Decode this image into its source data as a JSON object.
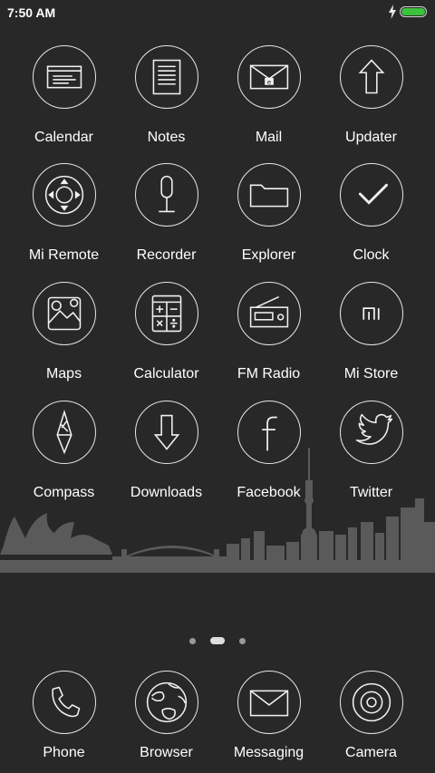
{
  "status_bar": {
    "time": "7:50 AM",
    "battery_level": 1.0,
    "battery_color": "#3cc23c",
    "charging": true
  },
  "apps": [
    {
      "label": "Calendar",
      "icon": "calendar-icon"
    },
    {
      "label": "Notes",
      "icon": "notes-icon"
    },
    {
      "label": "Mail",
      "icon": "mail-icon"
    },
    {
      "label": "Updater",
      "icon": "updater-icon"
    },
    {
      "label": "Mi Remote",
      "icon": "remote-icon"
    },
    {
      "label": "Recorder",
      "icon": "microphone-icon"
    },
    {
      "label": "Explorer",
      "icon": "folder-icon"
    },
    {
      "label": "Clock",
      "icon": "checkmark-icon"
    },
    {
      "label": "Maps",
      "icon": "map-icon"
    },
    {
      "label": "Calculator",
      "icon": "calculator-icon"
    },
    {
      "label": "FM Radio",
      "icon": "radio-icon"
    },
    {
      "label": "Mi Store",
      "icon": "mi-logo-icon"
    },
    {
      "label": "Compass",
      "icon": "compass-icon"
    },
    {
      "label": "Downloads",
      "icon": "download-arrow-icon"
    },
    {
      "label": "Facebook",
      "icon": "facebook-icon"
    },
    {
      "label": "Twitter",
      "icon": "twitter-bird-icon"
    }
  ],
  "page_indicator": {
    "pages": 3,
    "current": 2
  },
  "dock": [
    {
      "label": "Phone",
      "icon": "phone-icon"
    },
    {
      "label": "Browser",
      "icon": "globe-icon"
    },
    {
      "label": "Messaging",
      "icon": "envelope-icon"
    },
    {
      "label": "Camera",
      "icon": "camera-lens-icon"
    }
  ]
}
